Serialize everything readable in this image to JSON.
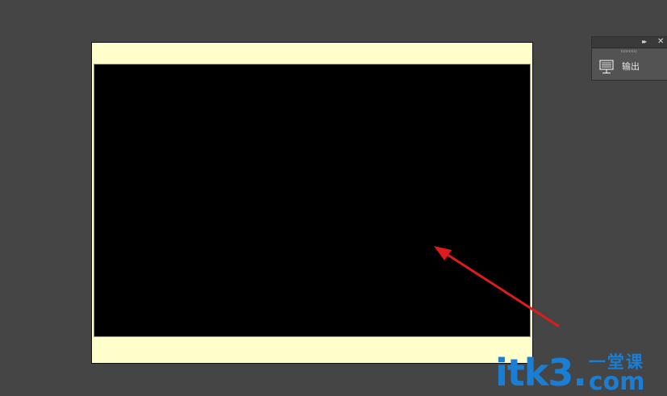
{
  "panel": {
    "output_label": "输出",
    "collapse_icon": "double-chevron-right-icon",
    "close_icon": "close-icon",
    "item_icon": "monitor-icon"
  },
  "watermark": {
    "main": "itk3",
    "dot": ".",
    "chinese": "一堂课",
    "suffix": "com"
  },
  "colors": {
    "workspace_bg": "#454545",
    "document_bg": "#ffffcc",
    "rect_fill": "#000000",
    "arrow": "#e01b1b",
    "watermark": "#1a7fd4"
  }
}
